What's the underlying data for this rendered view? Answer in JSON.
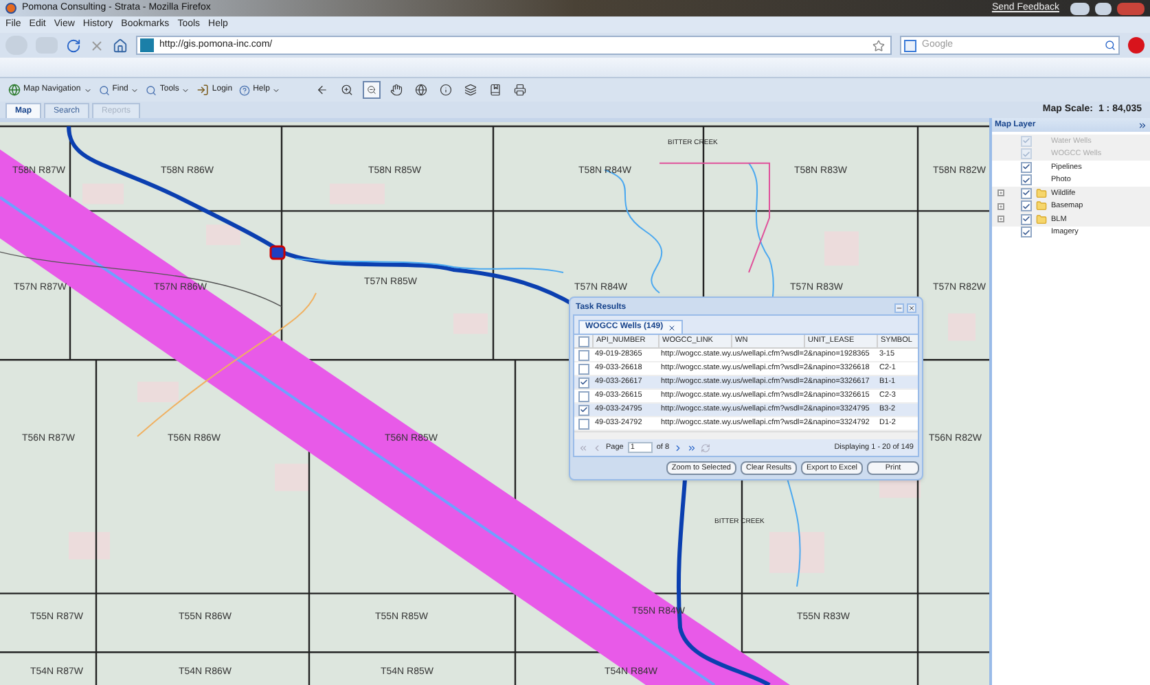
{
  "window": {
    "title": "Pomona Consulting - Strata - Mozilla Firefox",
    "feedback": "Send Feedback"
  },
  "menu": [
    "File",
    "Edit",
    "View",
    "History",
    "Bookmarks",
    "Tools",
    "Help"
  ],
  "address": {
    "url": "http://gis.pomona-inc.com/"
  },
  "search": {
    "placeholder": "Google"
  },
  "toolbar": {
    "menus": [
      "Map Navigation",
      "Find",
      "Tools"
    ],
    "login": "Login",
    "help": "Help",
    "tools": [
      {
        "kind": "back",
        "selected": false
      },
      {
        "kind": "zoom-in",
        "selected": false
      },
      {
        "kind": "zoom-out",
        "selected": true
      },
      {
        "kind": "pan",
        "selected": false
      },
      {
        "kind": "globe",
        "selected": false
      },
      {
        "kind": "info",
        "selected": false
      },
      {
        "kind": "layers",
        "selected": false
      },
      {
        "kind": "bookmark",
        "selected": false
      },
      {
        "kind": "print",
        "selected": false
      }
    ]
  },
  "tabs": [
    {
      "label": "Map",
      "selected": true,
      "disabled": false
    },
    {
      "label": "Search",
      "selected": false,
      "disabled": false
    },
    {
      "label": "Reports",
      "selected": false,
      "disabled": true
    }
  ],
  "map_scale": {
    "label": "Map Scale:",
    "value": "1 : 84,035"
  },
  "map": {
    "labels": [
      "T58N R87W",
      "T58N R86W",
      "T58N R85W",
      "T58N R84W",
      "T58N R83W",
      "T58N R82W",
      "T57N R87W",
      "T57N R86W",
      "T57N R85W",
      "T57N R84W",
      "T57N R83W",
      "T57N R82W",
      "T56N R87W",
      "T56N R86W",
      "T56N R85W",
      "T56N R82W",
      "T55N R87W",
      "T55N R86W",
      "T55N R85W",
      "T55N R84W",
      "T55N R83W",
      "T54N R87W",
      "T54N R86W",
      "T54N R85W",
      "T54N R84W"
    ],
    "creeks": [
      "BITTER CREEK",
      "BITTER CREEK"
    ]
  },
  "task_results": {
    "title": "Task Results",
    "tab": "WOGCC Wells (149)",
    "all_selected": false,
    "columns": [
      "API_NUMBER",
      "WOGCC_LINK",
      "WN",
      "UNIT_LEASE",
      "SYMBOL"
    ],
    "rows": [
      {
        "api": "49-019-28365",
        "link": "http://wogcc.state.wy.us/wellapi.cfm?wsdl=2&napino=1928365",
        "symbol": "3-15",
        "selected": false
      },
      {
        "api": "49-033-26618",
        "link": "http://wogcc.state.wy.us/wellapi.cfm?wsdl=2&napino=3326618",
        "symbol": "C2-1",
        "selected": false
      },
      {
        "api": "49-033-26617",
        "link": "http://wogcc.state.wy.us/wellapi.cfm?wsdl=2&napino=3326617",
        "symbol": "B1-1",
        "selected": true
      },
      {
        "api": "49-033-26615",
        "link": "http://wogcc.state.wy.us/wellapi.cfm?wsdl=2&napino=3326615",
        "symbol": "C2-3",
        "selected": false
      },
      {
        "api": "49-033-24795",
        "link": "http://wogcc.state.wy.us/wellapi.cfm?wsdl=2&napino=3324795",
        "symbol": "B3-2",
        "selected": true
      },
      {
        "api": "49-033-24792",
        "link": "http://wogcc.state.wy.us/wellapi.cfm?wsdl=2&napino=3324792",
        "symbol": "D1-2",
        "selected": false
      }
    ],
    "pager": {
      "page_label": "Page",
      "page": "1",
      "of": "of 8",
      "status": "Displaying 1 - 20 of 149"
    },
    "buttons": [
      "Zoom to Selected",
      "Clear Results",
      "Export to Excel",
      "Print"
    ]
  },
  "layers": {
    "title": "Map Layer",
    "items": [
      {
        "label": "Water Wells",
        "kind": "layer",
        "checked": true,
        "disabled": true
      },
      {
        "label": "WOGCC Wells",
        "kind": "layer",
        "checked": true,
        "disabled": true
      },
      {
        "label": "Pipelines",
        "kind": "layer",
        "checked": true,
        "disabled": false
      },
      {
        "label": "Photo",
        "kind": "layer",
        "checked": true,
        "disabled": false
      },
      {
        "label": "Wildlife",
        "kind": "folder",
        "checked": true,
        "disabled": false
      },
      {
        "label": "Basemap",
        "kind": "folder",
        "checked": true,
        "disabled": false
      },
      {
        "label": "BLM",
        "kind": "folder",
        "checked": true,
        "disabled": false
      },
      {
        "label": "Imagery",
        "kind": "layer",
        "checked": true,
        "disabled": false
      }
    ]
  }
}
